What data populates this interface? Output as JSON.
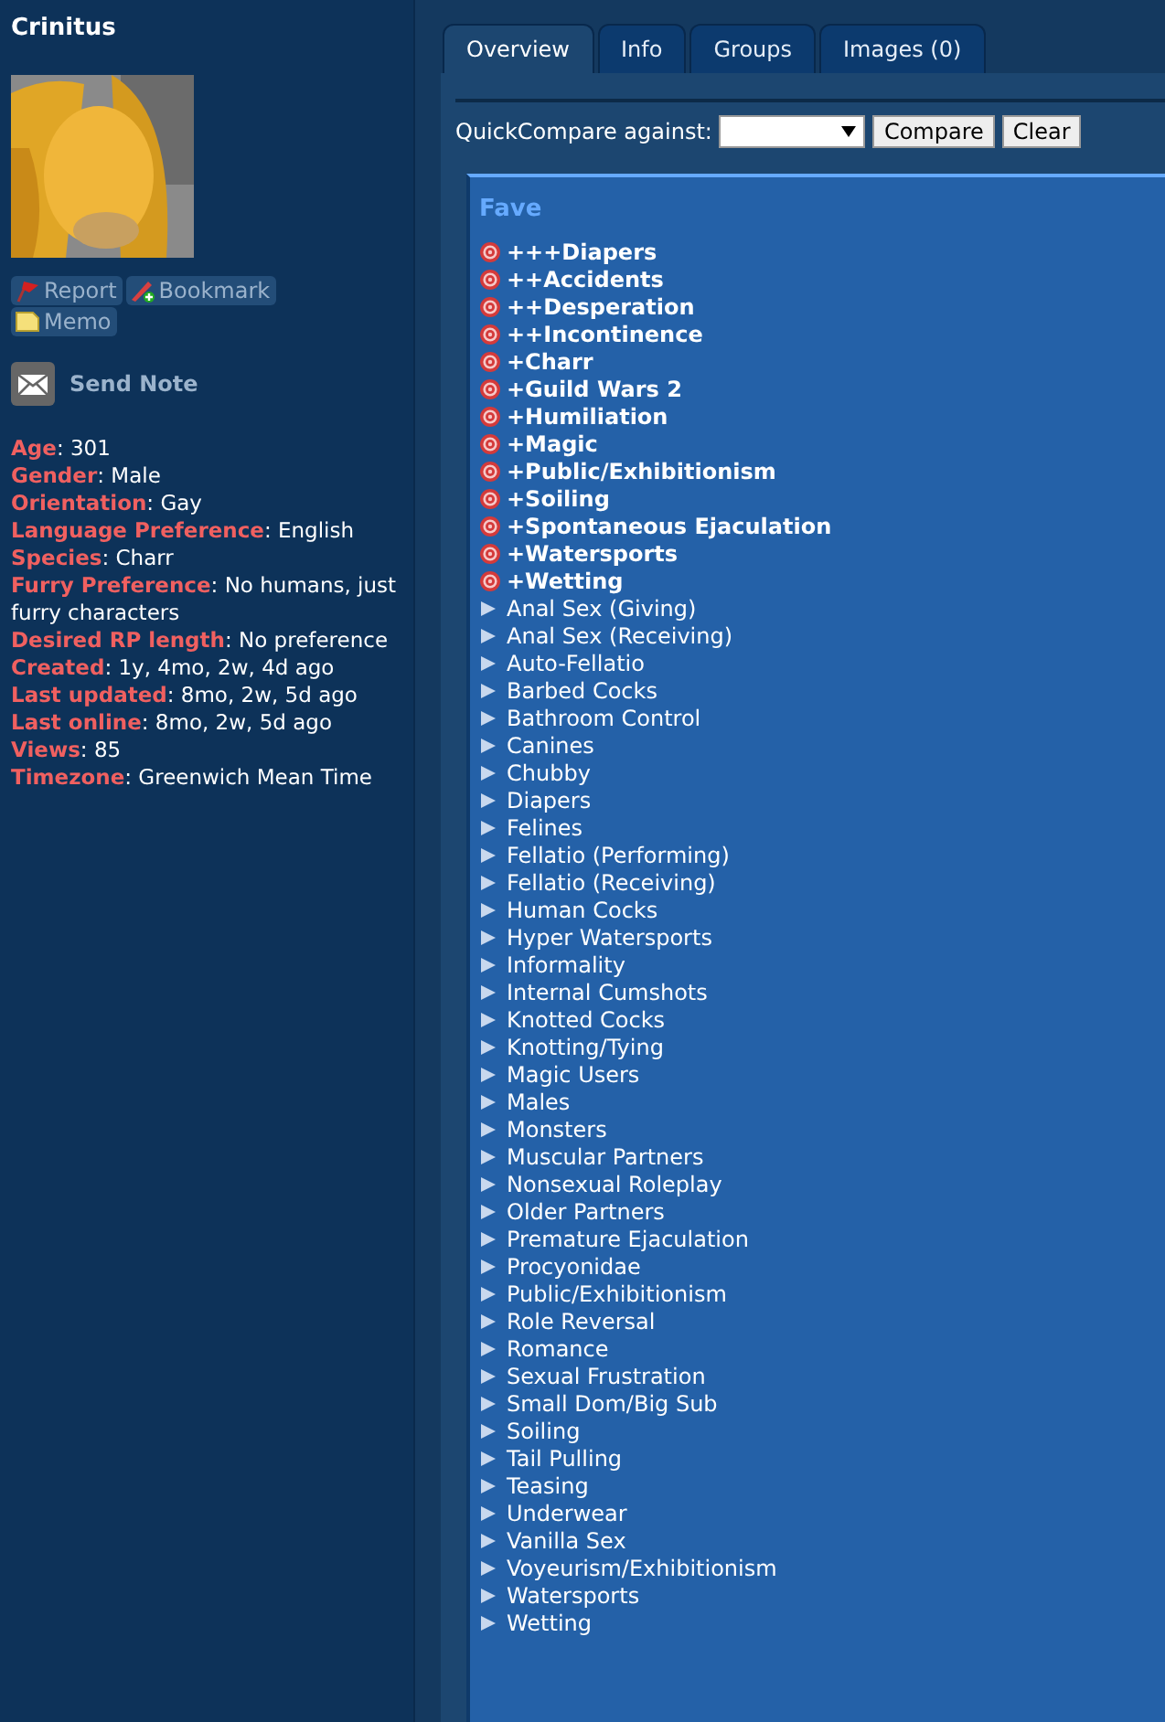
{
  "profile": {
    "name": "Crinitus",
    "avatar": {
      "kind": "picture"
    },
    "actions": [
      "Report",
      "Bookmark",
      "Memo"
    ],
    "send_note": "Send Note",
    "fields": [
      "**Age**: 301",
      "**Gender**: Male",
      "**Orientation**: Gay",
      "**Language Preference**: English",
      "**Species**: Charr",
      "**Furry Preference**: No humans, just furry characters",
      "**Desired RP length**: No preference",
      "**Created**: 1y, 4mo, 2w, 4d ago",
      "**Last updated**: 8mo, 2w, 5d ago",
      "**Last online**: 8mo, 2w, 5d ago",
      "**Views**: 85",
      "**Timezone**: Greenwich Mean Time"
    ]
  },
  "tabs": [
    {
      "label": "Overview",
      "selected": true
    },
    {
      "label": "Info",
      "selected": false
    },
    {
      "label": "Groups",
      "selected": false
    },
    {
      "label": "Images (0)",
      "selected": false
    }
  ],
  "quick_compare": {
    "label": "QuickCompare against:",
    "buttons": [
      "Compare",
      "Clear"
    ]
  },
  "fave": {
    "title": "Fave",
    "items": [
      {
        "kind": "custom",
        "label": "+++Diapers"
      },
      {
        "kind": "custom",
        "label": "++Accidents"
      },
      {
        "kind": "custom",
        "label": "++Desperation"
      },
      {
        "kind": "custom",
        "label": "++Incontinence"
      },
      {
        "kind": "custom",
        "label": "+Charr"
      },
      {
        "kind": "custom",
        "label": "+Guild Wars 2"
      },
      {
        "kind": "custom",
        "label": "+Humiliation"
      },
      {
        "kind": "custom",
        "label": "+Magic"
      },
      {
        "kind": "custom",
        "label": "+Public/Exhibitionism"
      },
      {
        "kind": "custom",
        "label": "+Soiling"
      },
      {
        "kind": "custom",
        "label": "+Spontaneous Ejaculation"
      },
      {
        "kind": "custom",
        "label": "+Watersports"
      },
      {
        "kind": "custom",
        "label": "+Wetting"
      },
      {
        "kind": "standard",
        "label": "Anal Sex (Giving)"
      },
      {
        "kind": "standard",
        "label": "Anal Sex (Receiving)"
      },
      {
        "kind": "standard",
        "label": "Auto-Fellatio"
      },
      {
        "kind": "standard",
        "label": "Barbed Cocks"
      },
      {
        "kind": "standard",
        "label": "Bathroom Control"
      },
      {
        "kind": "standard",
        "label": "Canines"
      },
      {
        "kind": "standard",
        "label": "Chubby"
      },
      {
        "kind": "standard",
        "label": "Diapers"
      },
      {
        "kind": "standard",
        "label": "Felines"
      },
      {
        "kind": "standard",
        "label": "Fellatio (Performing)"
      },
      {
        "kind": "standard",
        "label": "Fellatio (Receiving)"
      },
      {
        "kind": "standard",
        "label": "Human Cocks"
      },
      {
        "kind": "standard",
        "label": "Hyper Watersports"
      },
      {
        "kind": "standard",
        "label": "Informality"
      },
      {
        "kind": "standard",
        "label": "Internal Cumshots"
      },
      {
        "kind": "standard",
        "label": "Knotted Cocks"
      },
      {
        "kind": "standard",
        "label": "Knotting/Tying"
      },
      {
        "kind": "standard",
        "label": "Magic Users"
      },
      {
        "kind": "standard",
        "label": "Males"
      },
      {
        "kind": "standard",
        "label": "Monsters"
      },
      {
        "kind": "standard",
        "label": "Muscular Partners"
      },
      {
        "kind": "standard",
        "label": "Nonsexual Roleplay"
      },
      {
        "kind": "standard",
        "label": "Older Partners"
      },
      {
        "kind": "standard",
        "label": "Premature Ejaculation"
      },
      {
        "kind": "standard",
        "label": "Procyonidae"
      },
      {
        "kind": "standard",
        "label": "Public/Exhibitionism"
      },
      {
        "kind": "standard",
        "label": "Role Reversal"
      },
      {
        "kind": "standard",
        "label": "Romance"
      },
      {
        "kind": "standard",
        "label": "Sexual Frustration"
      },
      {
        "kind": "standard",
        "label": "Small Dom/Big Sub"
      },
      {
        "kind": "standard",
        "label": "Soiling"
      },
      {
        "kind": "standard",
        "label": "Tail Pulling"
      },
      {
        "kind": "standard",
        "label": "Teasing"
      },
      {
        "kind": "standard",
        "label": "Underwear"
      },
      {
        "kind": "standard",
        "label": "Vanilla Sex"
      },
      {
        "kind": "standard",
        "label": "Voyeurism/Exhibitionism"
      },
      {
        "kind": "standard",
        "label": "Watersports"
      },
      {
        "kind": "standard",
        "label": "Wetting"
      }
    ]
  }
}
